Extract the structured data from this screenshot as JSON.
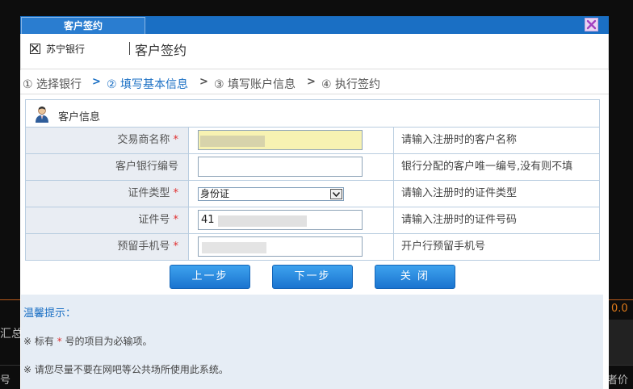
{
  "background": {
    "left_text_1": "汇总",
    "left_text_2": "号",
    "right_text_1": "0.0",
    "right_text_2": "者价差"
  },
  "dialog": {
    "title": "客户签约",
    "close_icon": "close-icon",
    "bank_name": "苏宁银行",
    "header_title": "客户签约",
    "steps": [
      {
        "label": "① 选择银行",
        "active": false
      },
      {
        "label": "② 填写基本信息",
        "active": true
      },
      {
        "label": "③ 填写账户信息",
        "active": false
      },
      {
        "label": "④ 执行签约",
        "active": false
      }
    ],
    "section_title": "客户信息",
    "fields": [
      {
        "label": "交易商名称",
        "required": "*",
        "value": "",
        "hint": "请输入注册时的客户名称"
      },
      {
        "label": "客户银行编号",
        "required": "",
        "value": "",
        "hint": "银行分配的客户唯一编号,没有则不填"
      },
      {
        "label": "证件类型",
        "required": "*",
        "value": "身份证",
        "hint": "请输入注册时的证件类型"
      },
      {
        "label": "证件号",
        "required": "*",
        "value": "41",
        "hint": "请输入注册时的证件号码"
      },
      {
        "label": "预留手机号",
        "required": "*",
        "value": "",
        "hint": "开户行预留手机号"
      }
    ],
    "buttons": {
      "prev": "上一步",
      "next": "下一步",
      "close": "关 闭"
    },
    "notice": {
      "title": "温馨提示：",
      "line1_prefix": "※ 标有 ",
      "line1_star": "*",
      "line1_suffix": " 号的项目为必输项。",
      "line2": "※ 请您尽量不要在网吧等公共场所使用此系统。"
    }
  }
}
